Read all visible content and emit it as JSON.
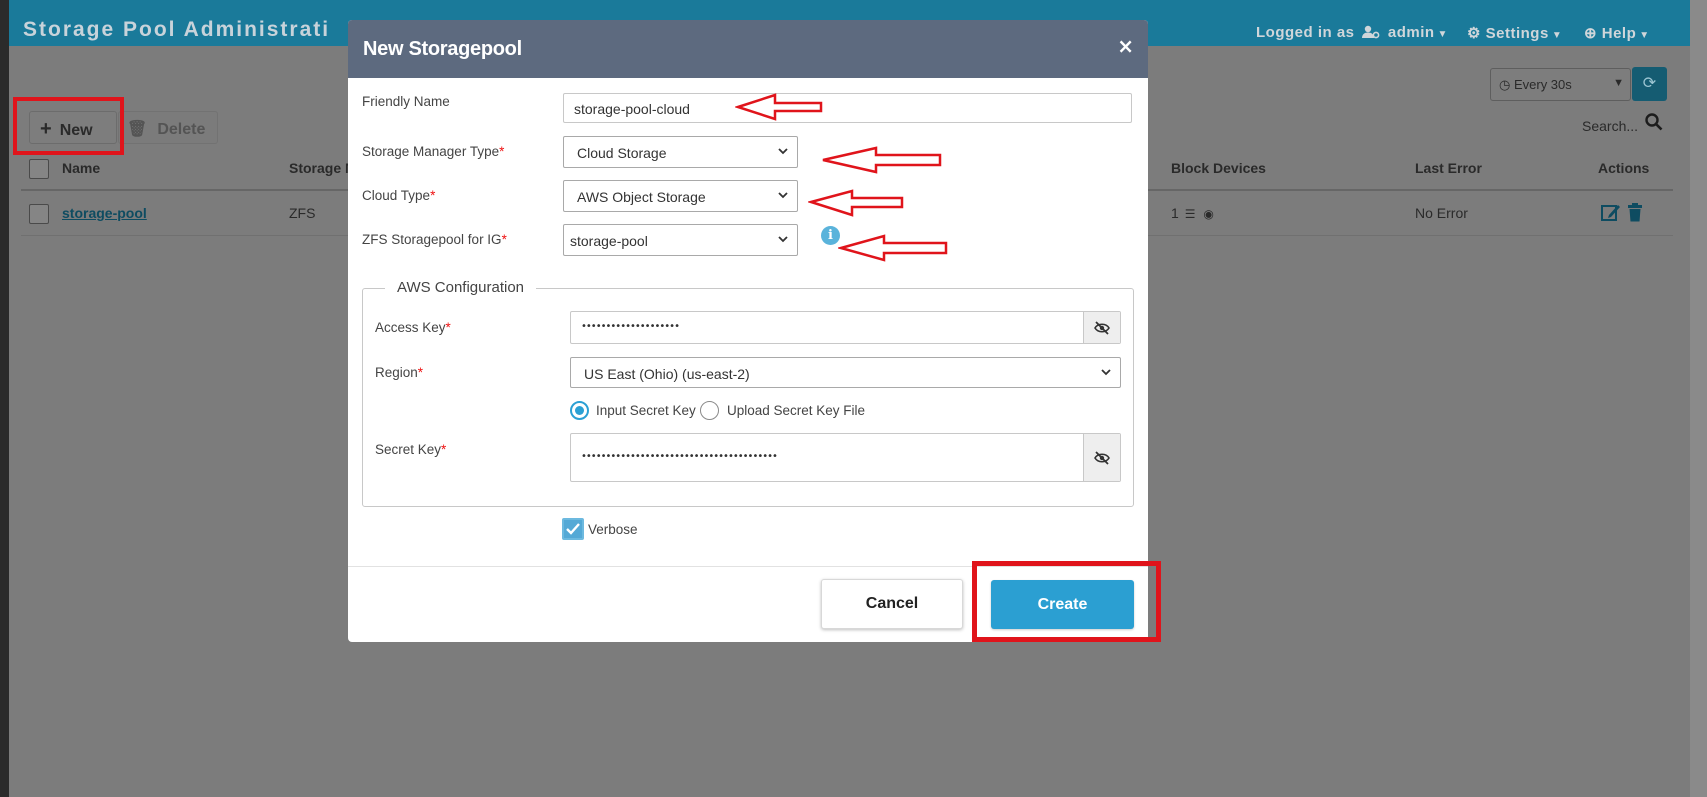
{
  "app": {
    "title": "Storage Pool Administrati"
  },
  "header_menu": {
    "logged_in_prefix": "Logged in as",
    "user": "admin",
    "settings": "Settings",
    "help": "Help"
  },
  "toolbar": {
    "refresh_interval": "Every 30s",
    "new_label": "New",
    "delete_label": "Delete",
    "search_label": "Search..."
  },
  "grid": {
    "columns": [
      "Name",
      "Storage M",
      "Block Devices",
      "Last Error",
      "Actions"
    ],
    "rows": [
      {
        "name": "storage-pool",
        "storage_manager": "ZFS",
        "block_devices": "1",
        "last_error": "No Error"
      }
    ]
  },
  "modal": {
    "title": "New Storagepool",
    "close": "×",
    "friendly_name": {
      "label": "Friendly Name",
      "value": "storage-pool-cloud"
    },
    "storage_manager_type": {
      "label": "Storage Manager Type",
      "value": "Cloud Storage"
    },
    "cloud_type": {
      "label": "Cloud Type",
      "value": "AWS Object Storage"
    },
    "zfs_pool": {
      "label": "ZFS Storagepool for IG",
      "value": "storage-pool"
    },
    "aws": {
      "legend": "AWS Configuration",
      "access_key_label": "Access Key",
      "access_key_mask": "••••••••••••••••••••",
      "region_label": "Region",
      "region_value": "US East (Ohio) (us-east-2)",
      "radio_input": "Input Secret Key",
      "radio_upload": "Upload Secret Key File",
      "secret_key_label": "Secret Key",
      "secret_key_mask": "••••••••••••••••••••••••••••••••••••••••"
    },
    "verbose_label": "Verbose",
    "cancel": "Cancel",
    "create": "Create"
  },
  "required_mark": "*",
  "colors": {
    "header": "#1a7a9a",
    "modal_header": "#5d6a7f",
    "primary": "#2b9fd2",
    "annotation": "#e0141b"
  }
}
